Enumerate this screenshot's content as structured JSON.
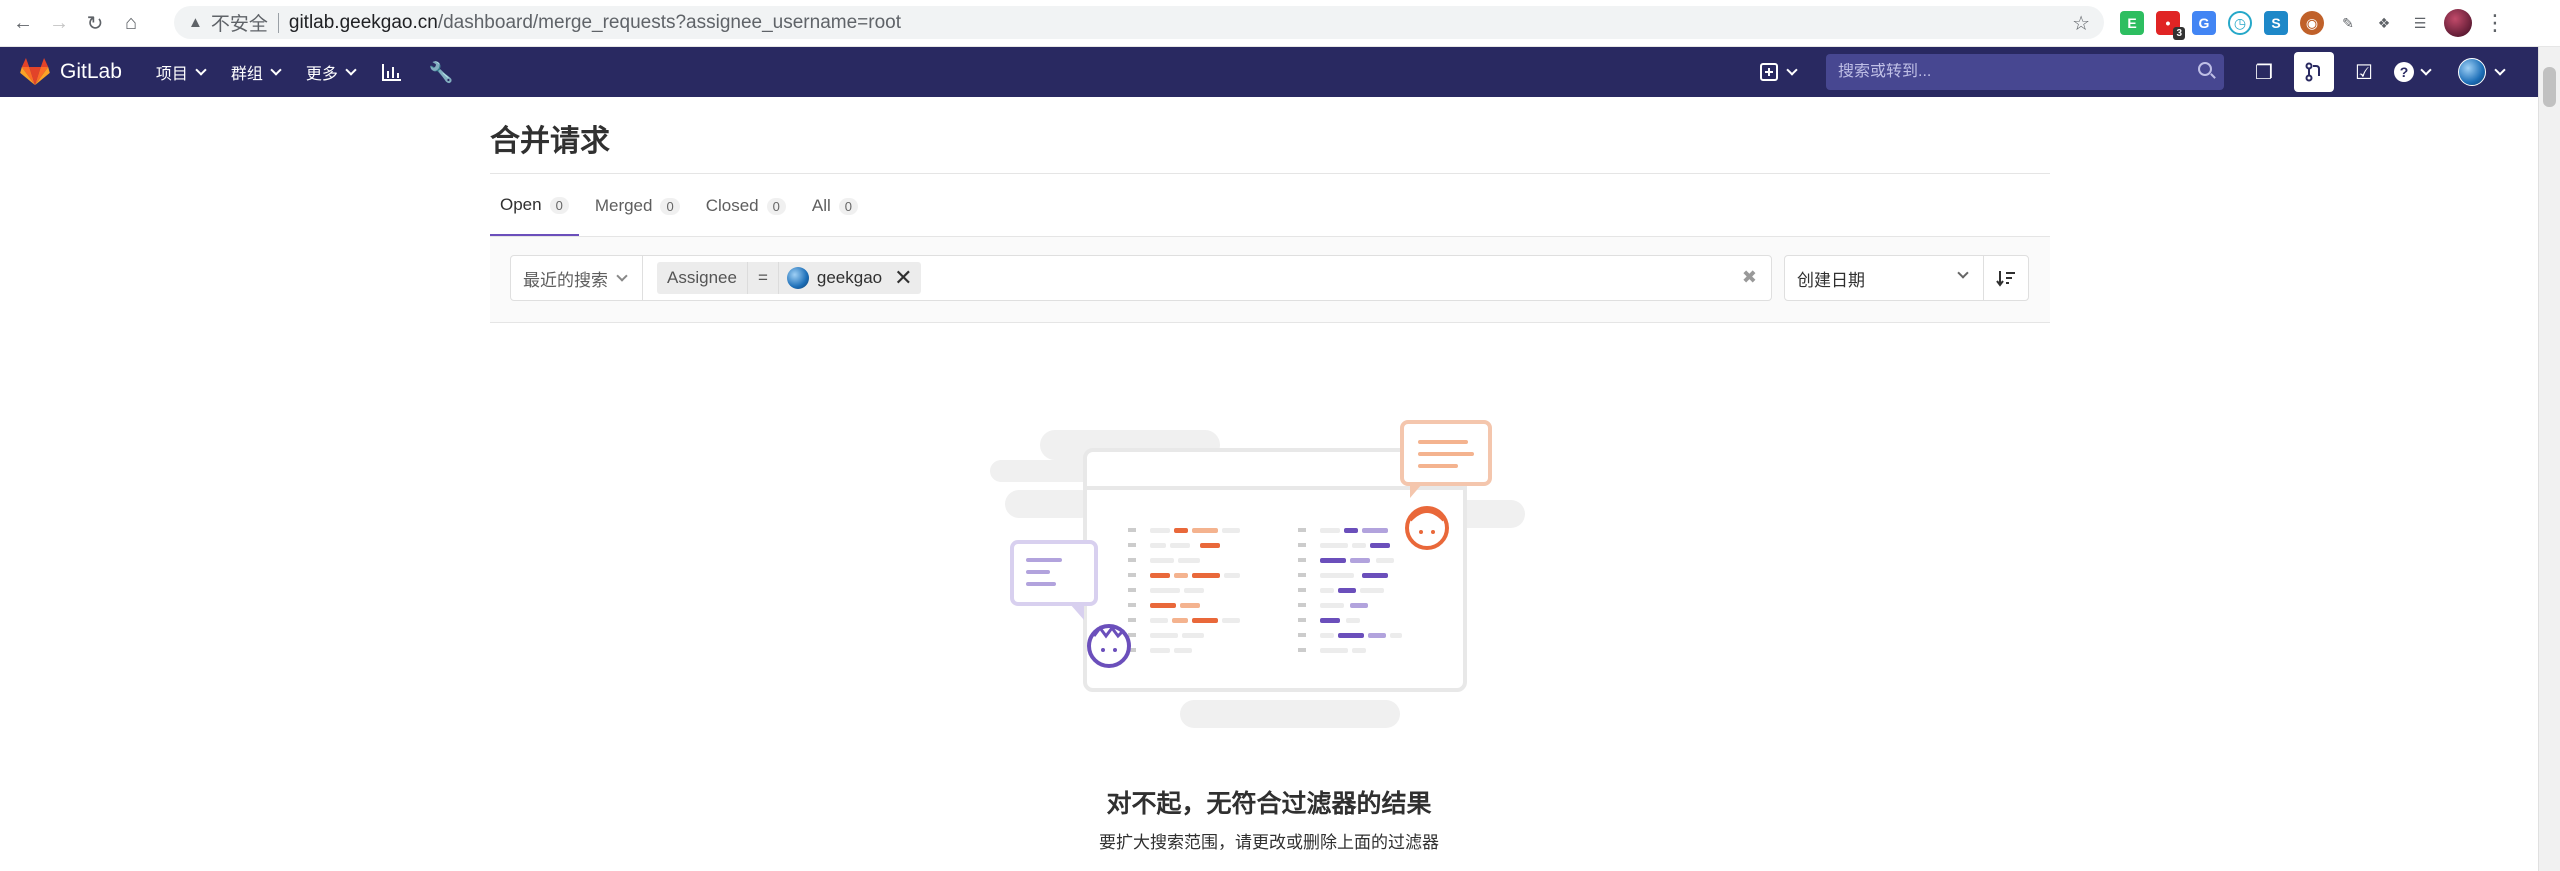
{
  "browser": {
    "insecure_label": "不安全",
    "url_host": "gitlab.geekgao.cn",
    "url_path": "/dashboard/merge_requests?assignee_username=root",
    "ext_badge": "3"
  },
  "navbar": {
    "brand": "GitLab",
    "menu": [
      {
        "label": "项目"
      },
      {
        "label": "群组"
      },
      {
        "label": "更多"
      }
    ],
    "search_placeholder": "搜索或转到..."
  },
  "page": {
    "title": "合并请求",
    "tabs": [
      {
        "label": "Open",
        "count": "0"
      },
      {
        "label": "Merged",
        "count": "0"
      },
      {
        "label": "Closed",
        "count": "0"
      },
      {
        "label": "All",
        "count": "0"
      }
    ]
  },
  "filter": {
    "recent_label": "最近的搜索",
    "token_name": "Assignee",
    "token_operator": "=",
    "token_value": "geekgao",
    "sort_label": "创建日期"
  },
  "empty_state": {
    "title": "对不起，无符合过滤器的结果",
    "subtitle": "要扩大搜索范围，请更改或删除上面的过滤器"
  },
  "colors": {
    "navbar_bg": "#292961",
    "tab_active_underline": "#6b4fbb",
    "illustration_orange": "#e9683a",
    "illustration_purple": "#6b4fbb"
  }
}
